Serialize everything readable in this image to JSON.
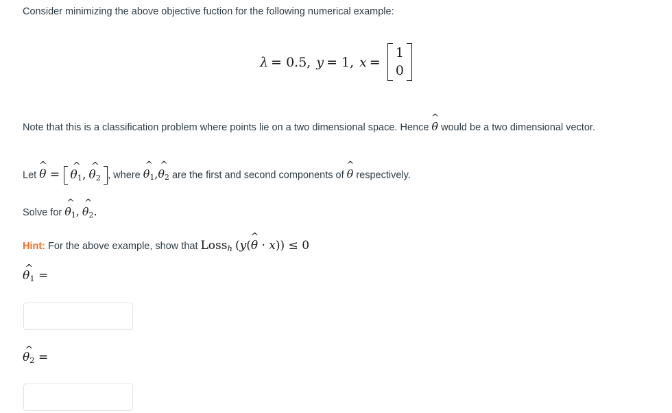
{
  "intro": {
    "text": "Consider minimizing the above objective fuction for the following numerical example:"
  },
  "equation": {
    "lambda_symbol": "λ",
    "lambda_eq": "= 0.5,",
    "y_symbol": "y",
    "y_eq": "= 1,",
    "x_symbol": "x",
    "x_eq": "=",
    "vector_values": [
      "1",
      "0"
    ]
  },
  "note": {
    "text_part1": "Note that this is a classification problem where points lie on a two dimensional space. Hence ",
    "theta_hat": "θ",
    "text_part2": " would be a two dimensional vector."
  },
  "let_line": {
    "prefix": "Let ",
    "theta": "θ",
    "equals": "=",
    "comp1": "θ",
    "comp1_sub": "1",
    "comma": ",",
    "comp2": "θ",
    "comp2_sub": "2",
    "mid_text": ", where ",
    "c1": "θ",
    "c1_sub": "1",
    "c2": "θ",
    "c2_sub": "2",
    "tail_text": " are the first and second components of ",
    "theta_end": "θ",
    "suffix": " respectively."
  },
  "solve_line": {
    "prefix": "Solve for ",
    "t1": "θ",
    "t1_sub": "1",
    "comma": ",",
    "t2": "θ",
    "t2_sub": "2",
    "period": "."
  },
  "hint": {
    "label": "Hint:",
    "text": "For the above example, show that",
    "loss_name": "Loss",
    "loss_sub": "h",
    "expr_open": "(",
    "y": "y",
    "inner_open": "(",
    "theta": "θ",
    "dot": "·",
    "x": "x",
    "inner_close": ")",
    "expr_close": ")",
    "relation": "≤ 0"
  },
  "answers": [
    {
      "label_symbol": "θ",
      "label_sub": "1",
      "label_equals": "=",
      "value": "",
      "placeholder": ""
    },
    {
      "label_symbol": "θ",
      "label_sub": "2",
      "label_equals": "=",
      "value": "",
      "placeholder": ""
    }
  ],
  "colors": {
    "text": "#2d3b45",
    "math": "#1a1a1a",
    "hint_accent": "#f26f21",
    "input_border": "#e2e4e7",
    "background": "#ffffff"
  }
}
